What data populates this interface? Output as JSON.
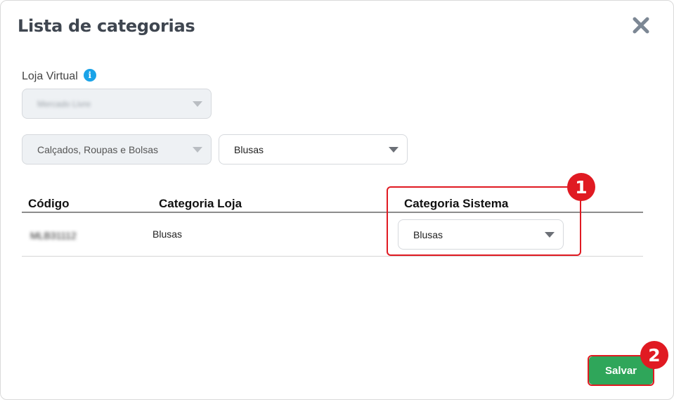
{
  "modal": {
    "title": "Lista de categorias",
    "close_icon": "close-icon"
  },
  "store_field": {
    "label": "Loja Virtual",
    "info_icon": "info-icon",
    "info_glyph": "i",
    "value": "Mercado Livre"
  },
  "filters": {
    "category_group": "Calçados, Roupas e Bolsas",
    "category": "Blusas"
  },
  "table": {
    "headers": [
      "Código",
      "Categoria Loja",
      "Categoria Sistema"
    ],
    "rows": [
      {
        "code": "MLB31112",
        "store_category": "Blusas",
        "system_category": "Blusas"
      }
    ]
  },
  "annotations": {
    "badge_1": "1",
    "badge_2": "2",
    "color": "#e01a22"
  },
  "footer": {
    "save_label": "Salvar",
    "save_color": "#2fa65a"
  }
}
